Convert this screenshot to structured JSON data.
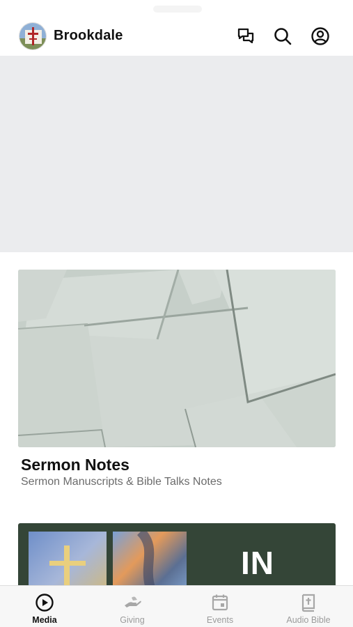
{
  "header": {
    "app_name": "Brookdale",
    "logo_icon": "church-cross-logo",
    "icons": [
      "chat-bubbles-icon",
      "search-icon",
      "account-circle-icon"
    ]
  },
  "hero": {
    "state": "loading-placeholder"
  },
  "cards": [
    {
      "title": "Sermon Notes",
      "subtitle": "Sermon Manuscripts & Bible Talks Notes",
      "image": "overlapping-paper-sheets-image"
    },
    {
      "image_text": "IN",
      "image": "cross-and-abstract-collage-image"
    }
  ],
  "tabbar": {
    "active": "Media",
    "tabs": [
      {
        "label": "Media",
        "icon": "play-circle-icon"
      },
      {
        "label": "Giving",
        "icon": "giving-hand-icon"
      },
      {
        "label": "Events",
        "icon": "calendar-icon"
      },
      {
        "label": "Audio Bible",
        "icon": "bible-book-icon"
      }
    ]
  },
  "colors": {
    "text_primary": "#111111",
    "text_secondary": "#6b6b6b",
    "tab_inactive": "#9b9b9b",
    "placeholder": "#ebecee",
    "card2_background": "#344537"
  }
}
